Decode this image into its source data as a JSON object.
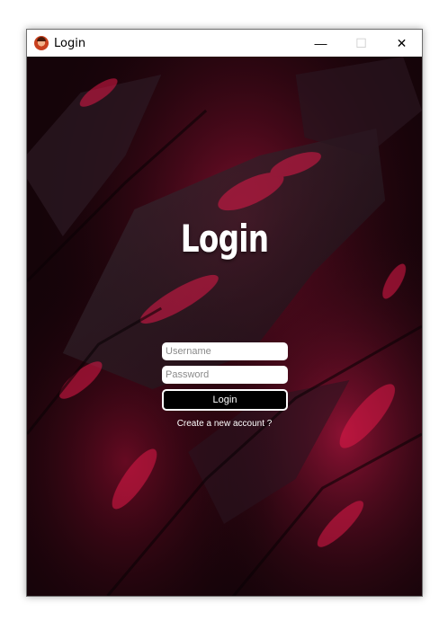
{
  "window": {
    "title": "Login",
    "minimize_glyph": "—",
    "maximize_glyph": "☐",
    "close_glyph": "✕"
  },
  "login": {
    "heading": "Login",
    "username_placeholder": "Username",
    "password_placeholder": "Password",
    "login_button": "Login",
    "create_account_link": "Create a new account ?"
  },
  "colors": {
    "background_dark": "#120308",
    "accent_red": "#c0143c",
    "button_bg": "#000000",
    "text_white": "#ffffff"
  },
  "icons": {
    "app": "app-avatar-icon"
  }
}
